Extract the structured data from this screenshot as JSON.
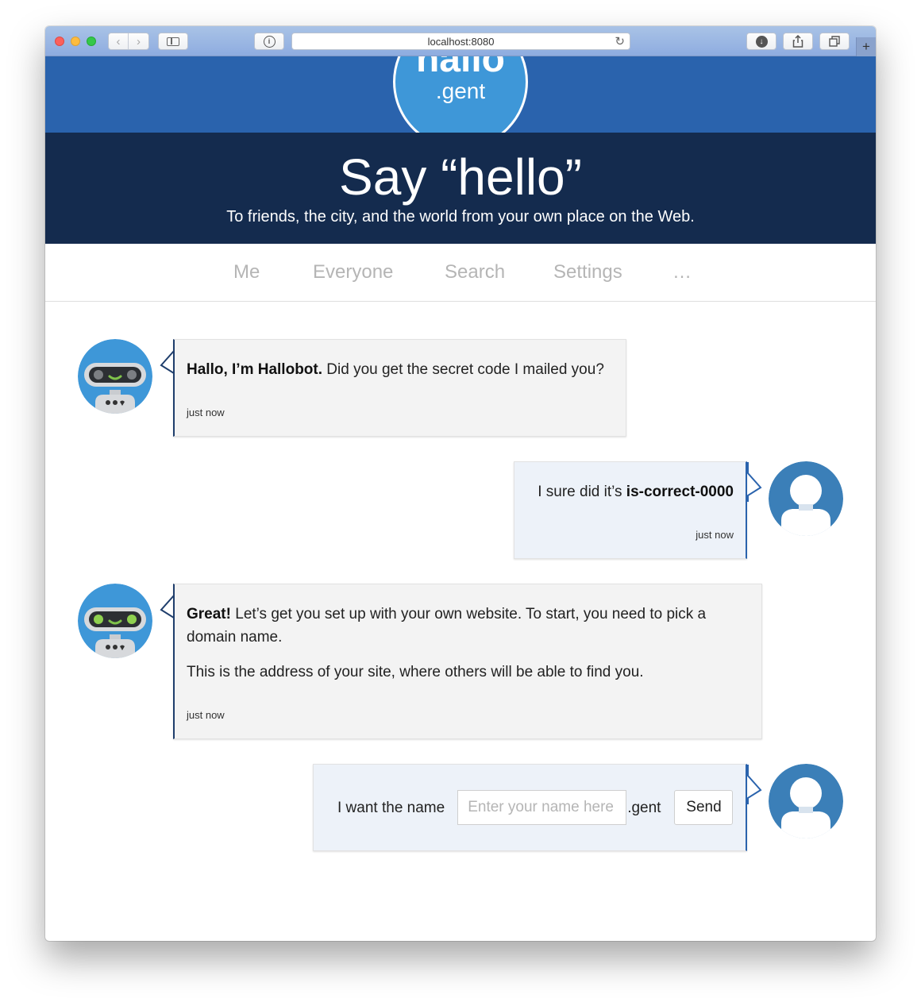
{
  "browser": {
    "url": "localhost:8080",
    "new_tab_label": "+"
  },
  "hero": {
    "logo_word": "hallo",
    "logo_tld": ".gent",
    "title": "Say “hello”",
    "subtitle": "To friends, the city, and the world from your own place on the Web."
  },
  "nav": {
    "items": [
      "Me",
      "Everyone",
      "Search",
      "Settings",
      "…"
    ]
  },
  "messages": {
    "m1": {
      "bold": "Hallo, I’m Hallobot.",
      "text": " Did you get the secret code I mailed you?",
      "time": "just now"
    },
    "m2": {
      "text": "I sure did it’s ",
      "bold": "is-correct-0000",
      "time": "just now"
    },
    "m3": {
      "bold": "Great!",
      "text": " Let’s get you set up with your own website. To start, you need to pick a domain name.",
      "text2": "This is the address of your site, where others will be able to find you.",
      "time": "just now"
    }
  },
  "reply": {
    "label": "I want the name",
    "placeholder": "Enter your name here",
    "value": "",
    "tld": ".gent",
    "send_label": "Send"
  },
  "colors": {
    "logo_band": "#2a63ad",
    "tagline_band": "#142b4e",
    "logo_circle": "#3e97d8",
    "user_avatar": "#3b7fb8",
    "bot_bubble": "#f3f3f3",
    "user_bubble": "#edf2f9"
  },
  "icons": {
    "bot_avatar": "robot-face-icon",
    "user_avatar": "person-silhouette-icon"
  }
}
